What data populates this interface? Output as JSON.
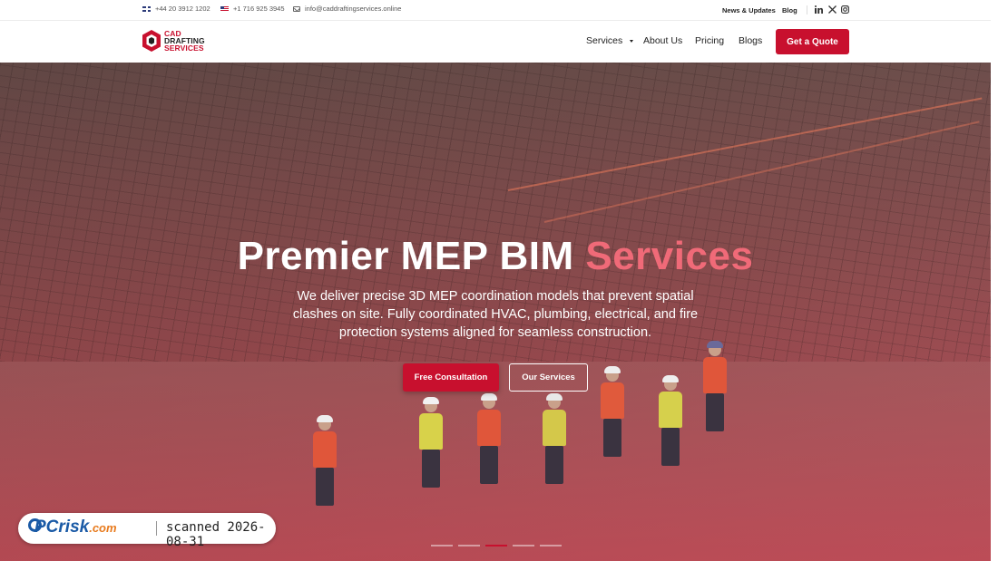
{
  "topbar": {
    "phone_uk": "+44 20 3912 1202",
    "phone_us": "+1 716 925 3945",
    "email": "info@caddraftingservices.online",
    "news_link": "News & Updates",
    "blog_link": "Blog",
    "social": [
      "linkedin-icon",
      "x-icon",
      "instagram-icon"
    ]
  },
  "header": {
    "logo": {
      "line1": "CAD",
      "line2": "DRAFTING",
      "line3": "SERVICES"
    },
    "nav": [
      {
        "label": "Services",
        "has_dropdown": true
      },
      {
        "label": "About Us"
      },
      {
        "label": "Pricing"
      },
      {
        "label": "Blogs"
      }
    ],
    "cta": "Get a Quote"
  },
  "hero": {
    "title_main": "Premier MEP BIM",
    "title_accent": "Services",
    "description": "We deliver precise 3D MEP coordination models that prevent spatial clashes on site. Fully coordinated HVAC, plumbing, electrical, and fire protection systems aligned for seamless construction.",
    "primary_button": "Free Consultation",
    "secondary_button": "Our Services",
    "slides_total": 5,
    "active_slide": 3
  },
  "badge": {
    "brand": "PC",
    "brand_rest": "risk",
    "brand_domain": ".com",
    "scanned": "scanned 2026-08-31"
  },
  "colors": {
    "accent": "#c8102e",
    "accent_light": "#f06a78"
  }
}
